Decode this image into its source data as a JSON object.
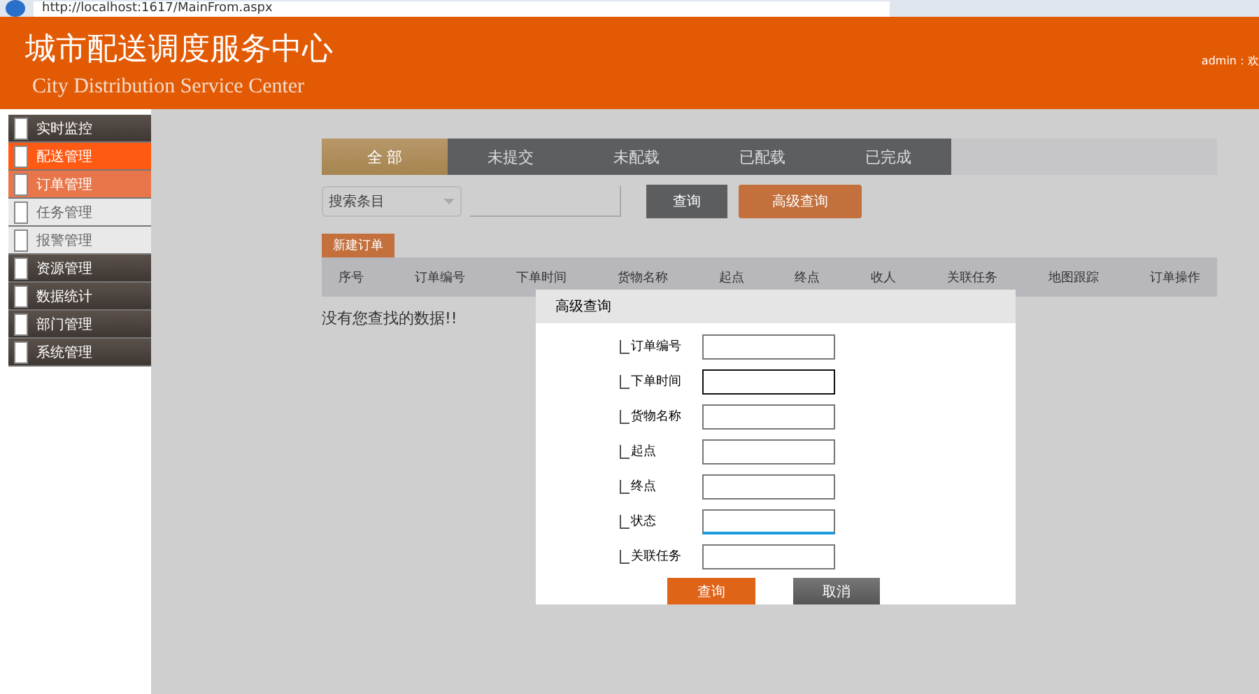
{
  "browser": {
    "address": "http://localhost:1617/MainFrom.aspx"
  },
  "header": {
    "title": "城市配送调度服务中心",
    "subtitle": "City Distribution Service Center",
    "user": "admin：欢"
  },
  "sidebar": {
    "items": [
      {
        "label": "实时监控",
        "selected": false,
        "kind": "main"
      },
      {
        "label": "配送管理",
        "selected": true,
        "kind": "main"
      },
      {
        "label": "订单管理",
        "selected": true,
        "kind": "sub"
      },
      {
        "label": "任务管理",
        "selected": false,
        "kind": "sub"
      },
      {
        "label": "报警管理",
        "selected": false,
        "kind": "sub"
      },
      {
        "label": "资源管理",
        "selected": false,
        "kind": "main"
      },
      {
        "label": "数据统计",
        "selected": false,
        "kind": "main"
      },
      {
        "label": "部门管理",
        "selected": false,
        "kind": "main"
      },
      {
        "label": "系统管理",
        "selected": false,
        "kind": "main"
      }
    ]
  },
  "tabs": [
    {
      "label": "全 部",
      "selected": true
    },
    {
      "label": "未提交",
      "selected": false
    },
    {
      "label": "未配载",
      "selected": false
    },
    {
      "label": "已配载",
      "selected": false
    },
    {
      "label": "已完成",
      "selected": false
    }
  ],
  "search": {
    "select": "搜索条目",
    "query_button": "查询",
    "advanced_button": "高级查询"
  },
  "new_order_button": "新建订单",
  "table": {
    "columns": [
      "序号",
      "订单编号",
      "下单时间",
      "货物名称",
      "起点",
      "终点",
      "收人",
      "关联任务",
      "地图跟踪",
      "订单操作"
    ],
    "empty_message": "没有您查找的数据!!"
  },
  "dialog": {
    "title": "高级查询",
    "fields": [
      {
        "label": "订单编号",
        "checked": false,
        "focused": false,
        "hovered": false
      },
      {
        "label": "下单时间",
        "checked": false,
        "focused": true,
        "hovered": false
      },
      {
        "label": "货物名称",
        "checked": false,
        "focused": false,
        "hovered": false
      },
      {
        "label": "起点",
        "checked": false,
        "focused": false,
        "hovered": false
      },
      {
        "label": "终点",
        "checked": false,
        "focused": false,
        "hovered": false
      },
      {
        "label": "状态",
        "checked": false,
        "focused": false,
        "hovered": true
      },
      {
        "label": "关联任务",
        "checked": false,
        "focused": false,
        "hovered": false
      }
    ],
    "buttons": [
      "查询",
      "取消"
    ]
  }
}
